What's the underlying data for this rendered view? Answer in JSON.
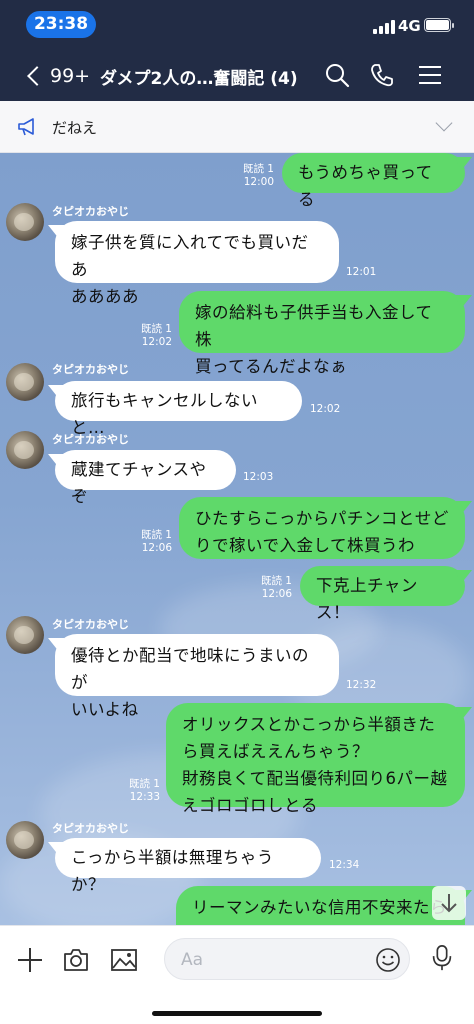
{
  "status_bar": {
    "time": "23:38",
    "network": "4G"
  },
  "header": {
    "back_count": "99+",
    "title": "ダメプ2人の…奮闘記 (4)"
  },
  "announcement": {
    "text": "だねえ"
  },
  "messages": [
    {
      "dir": "out",
      "text": "もうめちゃ買ってる",
      "read": "既読 1",
      "time": "12:00"
    },
    {
      "dir": "in",
      "sender": "タピオカおやじ",
      "text": "嫁子供を質に入れてでも買いだあ\nああああ",
      "time": "12:01"
    },
    {
      "dir": "out",
      "text": "嫁の給料も子供手当も入金して株\n買ってるんだよなぁ",
      "read": "既読 1",
      "time": "12:02"
    },
    {
      "dir": "in",
      "sender": "タピオカおやじ",
      "text": "旅行もキャンセルしないと…",
      "time": "12:02"
    },
    {
      "dir": "in",
      "sender": "タピオカおやじ",
      "text": "蔵建てチャンスやぞ",
      "time": "12:03"
    },
    {
      "dir": "out",
      "text": "ひたすらこっからパチンコとせど\nりで稼いで入金して株買うわ",
      "read": "既読 1",
      "time": "12:06"
    },
    {
      "dir": "out",
      "text": "下克上チャンス！",
      "read": "既読 1",
      "time": "12:06"
    },
    {
      "dir": "in",
      "sender": "タピオカおやじ",
      "text": "優待とか配当で地味にうまいのが\nいいよね",
      "time": "12:32"
    },
    {
      "dir": "out",
      "text": "オリックスとかこっから半額きた\nら買えばええんちゃう？\n財務良くて配当優待利回り6パー越\nえゴロゴロしとる",
      "read": "既読 1",
      "time": "12:33"
    },
    {
      "dir": "in",
      "sender": "タピオカおやじ",
      "text": "こっから半額は無理ちゃうか？",
      "time": "12:34"
    },
    {
      "dir": "out",
      "text": "リーマンみたいな信用不安来たら\n来るかも",
      "read": "",
      "time": ""
    }
  ],
  "input": {
    "placeholder": "Aa"
  }
}
